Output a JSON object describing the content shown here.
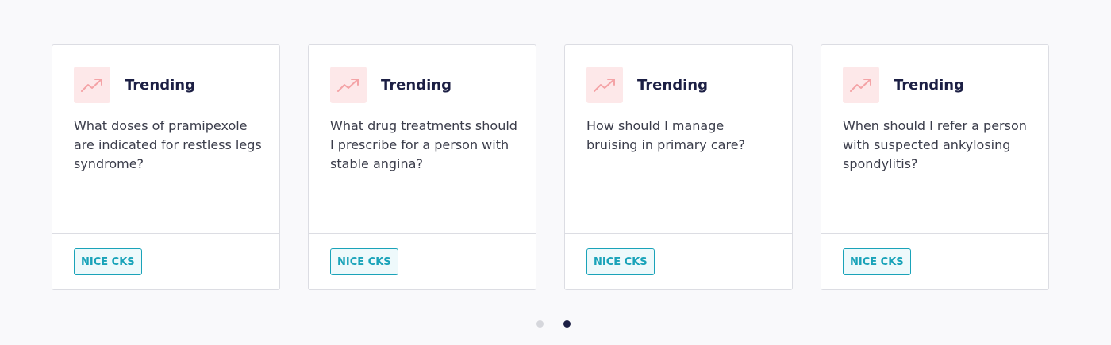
{
  "accent_color": "#f4a3a6",
  "badge_color": "#1aa3b9",
  "cards": [
    {
      "label": "Trending",
      "icon": "trending-up-icon",
      "question": "What doses of pramipexole are indicated for restless legs syndrome?",
      "source": "NICE CKS"
    },
    {
      "label": "Trending",
      "icon": "trending-up-icon",
      "question": "What drug treatments should I prescribe for a person with stable angina?",
      "source": "NICE CKS"
    },
    {
      "label": "Trending",
      "icon": "trending-up-icon",
      "question": "How should I manage bruising in primary care?",
      "source": "NICE CKS"
    },
    {
      "label": "Trending",
      "icon": "trending-up-icon",
      "question": "When should I refer a person with suspected ankylosing spondylitis?",
      "source": "NICE CKS"
    }
  ],
  "pagination": {
    "pages": 2,
    "active_page": 2
  }
}
